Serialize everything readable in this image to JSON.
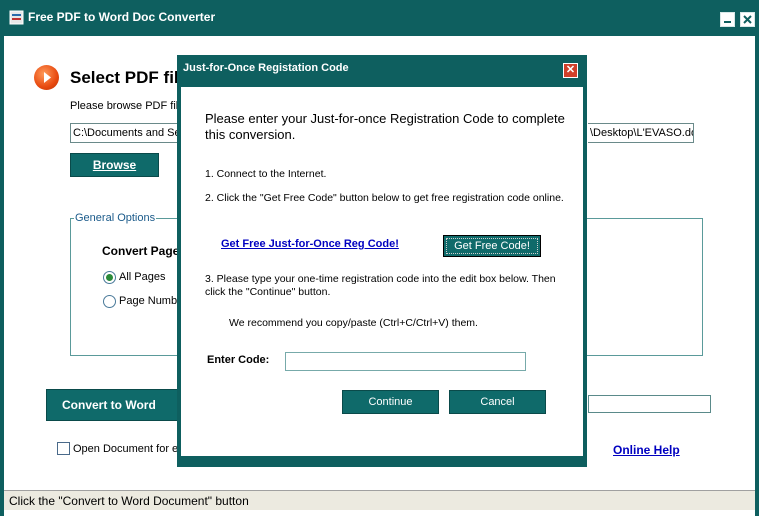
{
  "window": {
    "title": "Free PDF to Word Doc Converter",
    "section_title": "Select PDF fil",
    "browse_hint": "Please browse PDF file",
    "path_left": "C:\\Documents and Se",
    "path_right": "\\Desktop\\L'EVASO.do",
    "browse_label": "Browse",
    "options_legend": "General Options",
    "convert_pages_label": "Convert Page",
    "radio_all_label": "All Pages",
    "radio_num_label": "Page Numbe",
    "convert_label": "Convert to Word Doc",
    "open_doc_label": "Open Document for e",
    "online_help": "Online Help",
    "status": "Click the \"Convert to Word Document\" button"
  },
  "modal": {
    "title": "Just-for-Once Registation Code",
    "close_glyph": "✕",
    "heading": "Please enter your Just-for-once Registration Code to complete this conversion.",
    "step1": "1. Connect to the Internet.",
    "step2": "2. Click the \"Get Free Code\" button below to get free registration code online.",
    "link": "Get Free Just-for-Once Reg Code!",
    "get_free_btn": "Get Free Code!",
    "step3": "3. Please type your one-time registration code into the edit box below. Then click the \"Continue\" button.",
    "recommend": "We recommend you copy/paste (Ctrl+C/Ctrl+V) them.",
    "enter_code_label": "Enter Code:",
    "code_value": "",
    "continue_label": "Continue",
    "cancel_label": "Cancel"
  },
  "colors": {
    "accent": "#0e5f5f",
    "link": "#0000c0"
  }
}
